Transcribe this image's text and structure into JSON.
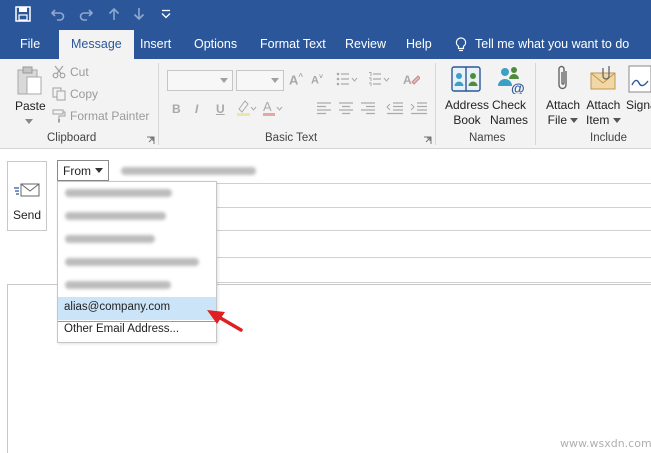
{
  "tabs": [
    "File",
    "Message",
    "Insert",
    "Options",
    "Format Text",
    "Review",
    "Help"
  ],
  "active_tab": "Message",
  "tell_me": "Tell me what you want to do",
  "ribbon": {
    "clipboard": {
      "paste": "Paste",
      "cut": "Cut",
      "copy": "Copy",
      "format_painter": "Format Painter",
      "label": "Clipboard"
    },
    "basic_text": {
      "label": "Basic Text"
    },
    "names": {
      "address_book": [
        "Address",
        "Book"
      ],
      "check_names": [
        "Check",
        "Names"
      ],
      "label": "Names"
    },
    "include": {
      "attach_file": [
        "Attach",
        "File"
      ],
      "attach_item": [
        "Attach",
        "Item"
      ],
      "signature": "Signa",
      "label": "Include"
    }
  },
  "compose": {
    "send": "Send",
    "from": "From"
  },
  "from_dropdown": {
    "items": [
      "alias@company.com",
      "Other Email Address..."
    ],
    "selected_index": 0
  },
  "colors": {
    "accent": "#2b579a",
    "selected": "#cce4f7",
    "arrow": "#e02020"
  },
  "watermark": "www.wsxdn.com"
}
